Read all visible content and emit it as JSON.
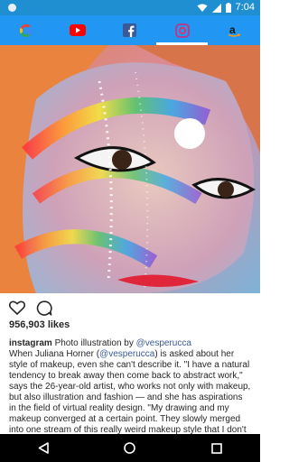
{
  "status": {
    "time": "7:04"
  },
  "tabs": [
    {
      "name": "google",
      "label": "G",
      "color": "#ea4335"
    },
    {
      "name": "youtube",
      "color": "#ff0000"
    },
    {
      "name": "facebook",
      "label": "f",
      "color": "#3b5998"
    },
    {
      "name": "instagram",
      "color": "#c13584",
      "active": true
    },
    {
      "name": "amazon",
      "label": "a",
      "color": "#ff9900"
    }
  ],
  "post": {
    "likes": "956,903 likes",
    "username": "instagram",
    "caption_intro": "Photo illustration by ",
    "mention1": "@vesperucca",
    "caption_1": "When Juliana Horner (",
    "mention2": "@vesperucca",
    "caption_2": ") is asked about her style of makeup, even she can't describe it. \"I have a natural tendency to break away then come back to abstract work,\" says the 26-year-old artist, who works not only with makeup, but also illustration and fashion — and she has aspirations in the field of virtual reality design. \"My drawing and my makeup converged at a certain point. They slowly merged into one stream of this really weird makeup style that I don't"
  }
}
